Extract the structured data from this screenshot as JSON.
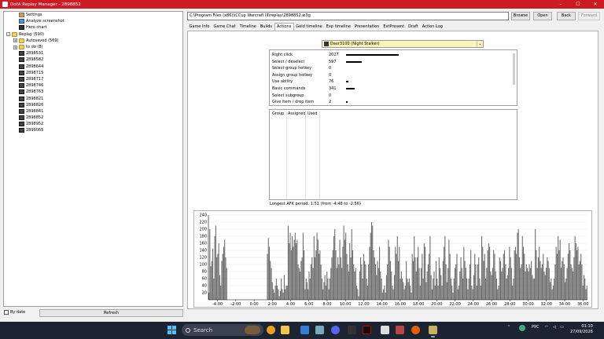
{
  "window": {
    "title": "DotA Replay Manager - 2898852"
  },
  "tree": {
    "items": [
      {
        "label": "Settings",
        "icon": "settings-icon",
        "indent": 1
      },
      {
        "label": "Analyze screenshot",
        "icon": "screenshot-icon",
        "indent": 1
      },
      {
        "label": "Hero chart",
        "icon": "hero-chart-icon",
        "indent": 1
      },
      {
        "label": "Replay (590)",
        "icon": "folder-icon",
        "indent": 0,
        "expander": "-"
      },
      {
        "label": "Autosaved (569)",
        "icon": "folder-icon",
        "indent": 1,
        "expander": "+"
      },
      {
        "label": "to do (8)",
        "icon": "folder-icon",
        "indent": 1,
        "expander": "+"
      },
      {
        "label": "2898531",
        "icon": "replay-icon",
        "indent": 1
      },
      {
        "label": "2898582",
        "icon": "replay-icon",
        "indent": 1
      },
      {
        "label": "2898644",
        "icon": "replay-icon",
        "indent": 1
      },
      {
        "label": "2898715",
        "icon": "replay-icon",
        "indent": 1
      },
      {
        "label": "2898717",
        "icon": "replay-icon",
        "indent": 1
      },
      {
        "label": "2898746",
        "icon": "replay-icon",
        "indent": 1
      },
      {
        "label": "2898763",
        "icon": "replay-icon",
        "indent": 1
      },
      {
        "label": "2898821",
        "icon": "replay-icon",
        "indent": 1
      },
      {
        "label": "2898826",
        "icon": "replay-icon",
        "indent": 1
      },
      {
        "label": "2898841",
        "icon": "replay-icon",
        "indent": 1
      },
      {
        "label": "2898852",
        "icon": "replay-icon",
        "indent": 1
      },
      {
        "label": "2898952",
        "icon": "replay-icon",
        "indent": 1
      },
      {
        "label": "2899065",
        "icon": "replay-icon",
        "indent": 1
      }
    ]
  },
  "left_bottom": {
    "bydate_label": "By date",
    "refresh_label": "Refresh"
  },
  "path": {
    "value": "C:\\Program Files (x86)\\iCCup Warcraft III\\replay\\2898852.w3g"
  },
  "buttons": {
    "browse": "Browse",
    "open": "Open",
    "back": "Back",
    "forward": "Forward"
  },
  "tabs": [
    "Game Info",
    "Game Chat",
    "Timeline",
    "Builds",
    "Actions",
    "Gold timeline",
    "Exp timeline",
    "Presentation",
    "ExtPresent",
    "Draft",
    "Action Log"
  ],
  "active_tab": "Actions",
  "player_select": {
    "value": "Davr3100 (Night Stalker)"
  },
  "actions": [
    {
      "name": "Right click",
      "count": 2027
    },
    {
      "name": "Select / deselect",
      "count": 597
    },
    {
      "name": "Select group hotkey",
      "count": 0
    },
    {
      "name": "Assign group hotkey",
      "count": 0
    },
    {
      "name": "Use ability",
      "count": 76
    },
    {
      "name": "Basic commands",
      "count": 341
    },
    {
      "name": "Select subgroup",
      "count": 0
    },
    {
      "name": "Give item / drop item",
      "count": 2
    }
  ],
  "group_table": {
    "headers": [
      "Group",
      "Assigned",
      "Used"
    ]
  },
  "afk_text": "Longest AFK period: 1:51 (from -4:48 to -2:56)",
  "chart_data": {
    "type": "bar",
    "ylim": [
      0,
      240
    ],
    "yticks": [
      20,
      40,
      60,
      80,
      100,
      120,
      140,
      160,
      180,
      200,
      220,
      240
    ],
    "xtick_labels": [
      "-4:00",
      "-2:00",
      "0:00",
      "2:00",
      "4:00",
      "6:00",
      "8:00",
      "10:00",
      "12:00",
      "14:00",
      "16:00",
      "18:00",
      "20:00",
      "22:00",
      "24:00",
      "26:00",
      "28:00",
      "30:00",
      "32:00",
      "34:00",
      "36:00"
    ],
    "xrange": [
      -5,
      36.5
    ],
    "values": [
      20,
      200,
      95,
      110,
      145,
      60,
      180,
      210,
      120,
      130,
      160,
      70,
      40,
      110,
      130,
      150,
      170,
      120,
      90,
      0,
      0,
      0,
      0,
      0,
      0,
      0,
      0,
      0,
      0,
      0,
      0,
      0,
      0,
      0,
      0,
      0,
      0,
      0,
      0,
      0,
      0,
      0,
      0,
      0,
      0,
      0,
      0,
      0,
      0,
      0,
      0,
      0,
      0,
      0,
      0,
      0,
      0,
      0,
      0,
      130,
      175,
      150,
      110,
      90,
      50,
      30,
      20,
      40,
      60,
      40,
      30,
      10,
      25,
      60,
      30,
      20,
      70,
      30,
      40,
      40,
      210,
      160,
      190,
      140,
      180,
      150,
      170,
      190,
      160,
      170,
      100,
      90,
      80,
      110,
      120,
      190,
      140,
      30,
      60,
      50,
      30,
      80,
      60,
      100,
      120,
      90,
      180,
      120,
      140,
      190,
      170,
      130,
      140,
      100,
      60,
      30,
      50,
      70,
      40,
      80,
      60,
      30,
      60,
      90,
      120,
      140,
      180,
      200,
      140,
      90,
      120,
      100,
      170,
      120,
      90,
      150,
      210,
      170,
      190,
      130,
      100,
      80,
      160,
      120,
      200,
      140,
      100,
      80,
      90,
      40,
      30,
      10,
      80,
      120,
      100,
      60,
      130,
      110,
      100,
      60,
      40,
      100,
      150,
      190,
      220,
      210,
      140,
      120,
      100,
      70,
      110,
      90,
      150,
      80,
      60,
      20,
      30,
      40,
      20,
      70,
      100,
      170,
      150,
      110,
      80,
      40,
      30,
      70,
      150,
      130,
      180,
      110,
      150,
      60,
      80,
      60,
      50,
      30,
      40,
      110,
      60,
      50,
      60,
      40,
      20,
      130,
      110,
      180,
      120,
      80,
      120,
      150,
      90,
      40,
      90,
      130,
      60,
      160,
      150,
      50,
      80,
      100,
      130,
      180,
      70,
      30,
      60,
      80,
      40,
      110,
      60,
      40,
      120,
      90,
      70,
      40,
      110,
      150,
      180,
      100,
      50,
      90,
      170,
      130,
      60,
      40,
      20,
      60,
      90,
      100,
      130,
      30,
      40,
      80,
      120,
      90,
      60,
      150,
      110,
      90,
      60,
      30,
      60,
      100,
      140,
      40,
      30,
      70,
      130,
      100,
      40,
      100,
      120,
      60,
      40,
      180,
      150,
      110,
      130,
      60,
      90,
      140,
      160,
      150,
      80,
      70,
      90,
      140,
      130,
      80,
      60,
      30,
      40,
      120,
      110,
      80,
      90,
      130,
      140,
      100,
      60,
      70,
      90,
      150,
      120,
      90,
      40,
      60,
      140,
      150,
      130,
      190,
      200,
      120,
      90,
      100,
      180,
      150,
      130,
      80,
      100,
      90,
      80,
      100,
      90,
      110,
      70,
      60,
      60,
      200,
      140,
      90,
      120,
      150,
      110,
      90,
      100,
      130,
      80,
      70,
      90,
      120,
      110,
      90,
      50,
      60,
      30,
      40,
      60,
      100,
      150,
      130,
      180,
      140,
      170,
      90,
      110,
      120,
      100,
      50,
      60,
      90,
      130,
      160,
      140,
      100,
      90,
      80,
      120,
      180,
      160,
      140,
      150,
      100,
      110,
      130,
      100,
      40,
      70,
      60,
      30,
      40
    ]
  },
  "taskbar": {
    "search_placeholder": "Search",
    "lang": "РУС",
    "time": "01:10",
    "date": "27/09/2026"
  },
  "colors": {
    "titlebar": "#cc1b22",
    "hero_select_bg": "#fbf3b8",
    "bar": "#6b6b6b"
  }
}
